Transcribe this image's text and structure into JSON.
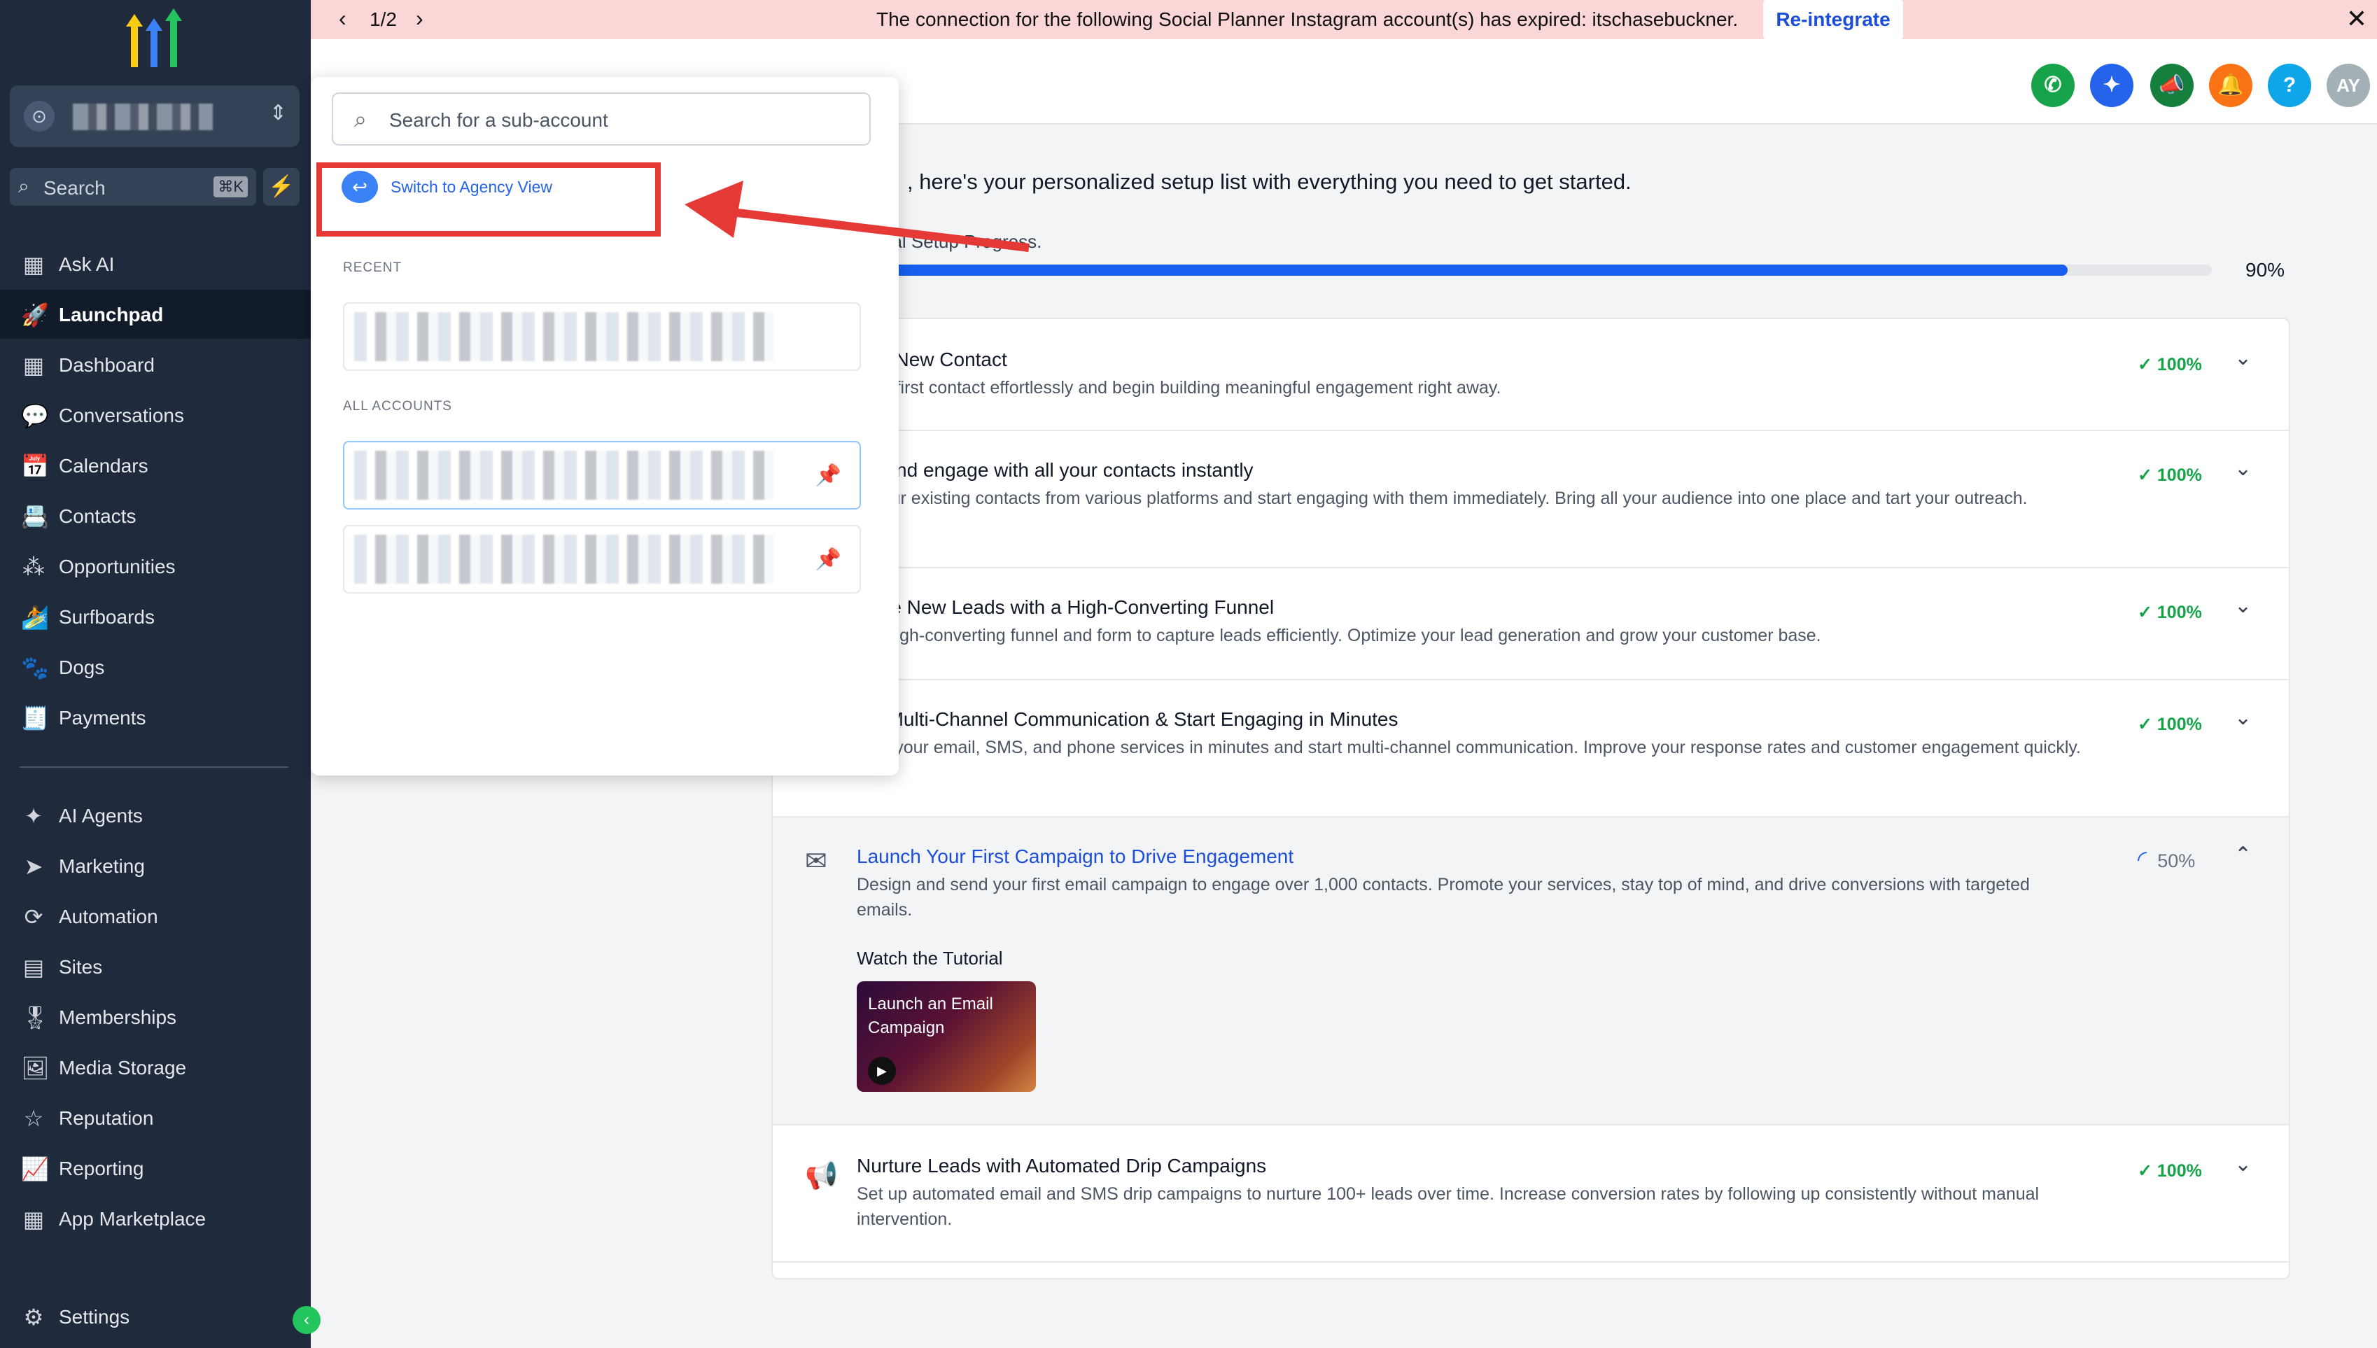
{
  "brand": {
    "accent": "#155eef",
    "sidebar_bg": "#1f2a3d",
    "success": "#16a34a",
    "banner_bg": "#fad6d6"
  },
  "banner": {
    "count": "1/2",
    "message": "The connection for the following Social Planner Instagram account(s) has expired: itschasebuckner.",
    "action_label": "Re-integrate"
  },
  "sidebar": {
    "search_label": "Search",
    "search_shortcut": "⌘K",
    "items_primary": [
      {
        "label": "Ask AI",
        "icon": "grid-icon"
      },
      {
        "label": "Launchpad",
        "icon": "rocket-icon",
        "active": true
      },
      {
        "label": "Dashboard",
        "icon": "grid-icon"
      },
      {
        "label": "Conversations",
        "icon": "chat-icon"
      },
      {
        "label": "Calendars",
        "icon": "calendar-icon"
      },
      {
        "label": "Contacts",
        "icon": "contacts-icon"
      },
      {
        "label": "Opportunities",
        "icon": "opportunities-icon"
      },
      {
        "label": "Surfboards",
        "icon": "surfboard-icon"
      },
      {
        "label": "Dogs",
        "icon": "dog-icon"
      },
      {
        "label": "Payments",
        "icon": "payments-icon"
      }
    ],
    "items_secondary": [
      {
        "label": "AI Agents",
        "icon": "sparkle-icon"
      },
      {
        "label": "Marketing",
        "icon": "send-icon"
      },
      {
        "label": "Automation",
        "icon": "automation-icon"
      },
      {
        "label": "Sites",
        "icon": "sites-icon"
      },
      {
        "label": "Memberships",
        "icon": "membership-icon"
      },
      {
        "label": "Media Storage",
        "icon": "image-icon"
      },
      {
        "label": "Reputation",
        "icon": "star-icon"
      },
      {
        "label": "Reporting",
        "icon": "trend-icon"
      },
      {
        "label": "App Marketplace",
        "icon": "grid-icon"
      }
    ],
    "settings_label": "Settings"
  },
  "header": {
    "avatar_initials": "AY"
  },
  "dropdown": {
    "search_placeholder": "Search for a sub-account",
    "switch_label": "Switch to Agency View",
    "recent_heading": "RECENT",
    "all_heading": "ALL ACCOUNTS"
  },
  "main": {
    "intro": ", here's your personalized setup list with everything you need to get started.",
    "progress_label": "nal Setup Progress.",
    "progress_value": 90,
    "progress_text": "90%",
    "tasks": [
      {
        "title": "te a New Contact",
        "desc": "your first contact effortlessly and begin building meaningful engagement right away.",
        "status": "100%"
      },
      {
        "title": "ort and engage with all your contacts instantly",
        "desc": "rt your existing contacts from various platforms and start engaging with them immediately. Bring all your audience into one place and tart your outreach.",
        "status": "100%"
      },
      {
        "title": "erate New Leads with a High-Converting Funnel",
        "desc": "p a high-converting funnel and form to capture leads efficiently. Optimize your lead generation and grow your customer base.",
        "status": "100%"
      },
      {
        "title": "Up Multi-Channel Communication & Start Engaging in Minutes",
        "desc": "nect your email, SMS, and phone services in minutes and start multi-channel communication. Improve your response rates and customer engagement quickly.",
        "status": "100%"
      },
      {
        "title": "Launch Your First Campaign to Drive Engagement",
        "desc": "Design and send your first email campaign to engage over 1,000 contacts. Promote your services, stay top of mind, and drive conversions with targeted emails.",
        "status": "50%",
        "tutorial_label": "Watch the Tutorial",
        "thumb_title": "Launch an Email Campaign"
      },
      {
        "title": "Nurture Leads with Automated Drip Campaigns",
        "desc": "Set up automated email and SMS drip campaigns to nurture 100+ leads over time. Increase conversion rates by following up consistently without manual intervention.",
        "status": "100%"
      }
    ]
  }
}
